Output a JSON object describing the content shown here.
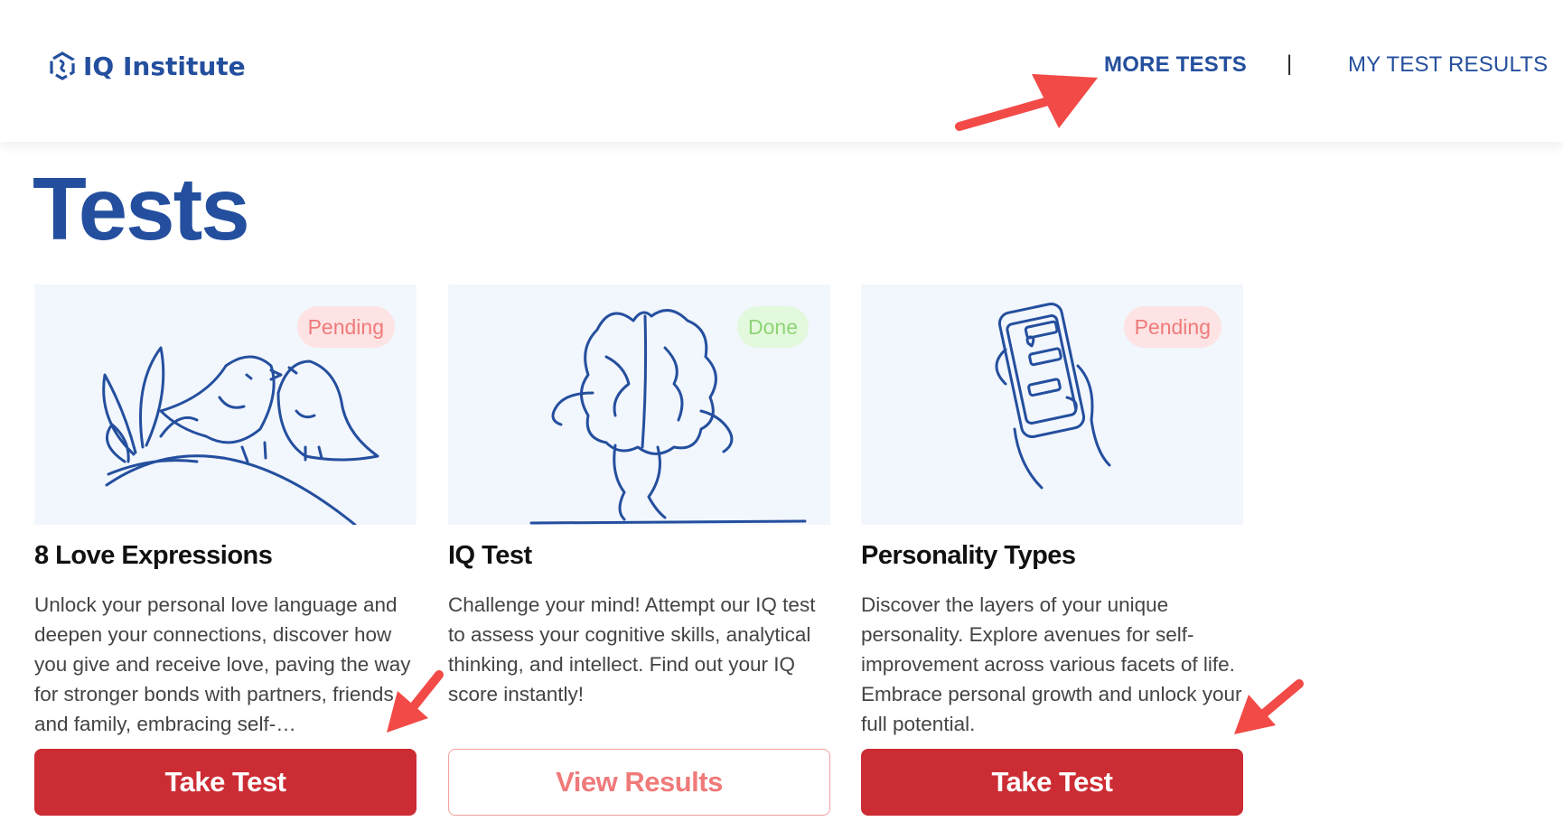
{
  "header": {
    "logo_text": "IQ Institute",
    "nav": {
      "more_tests": "MORE TESTS",
      "separator": "|",
      "my_results": "MY TEST RESULTS"
    }
  },
  "page": {
    "title": "Tests"
  },
  "cards": [
    {
      "title": "8 Love Expressions",
      "status": "Pending",
      "description": "Unlock your personal love language and deepen your connections, discover how you give and receive love, paving the way for stronger bonds with partners, friends, and family, embracing self-…",
      "button": "Take Test",
      "illustration": "birds-illustration"
    },
    {
      "title": "IQ Test",
      "status": "Done",
      "description": "Challenge your mind! Attempt our IQ test to assess your cognitive skills, analytical thinking, and intellect. Find out your IQ score instantly!",
      "button": "View Results",
      "illustration": "brain-illustration"
    },
    {
      "title": "Personality Types",
      "status": "Pending",
      "description": "Discover the layers of your unique personality. Explore avenues for self-improvement across various facets of life. Embrace personal growth and unlock your full potential.",
      "button": "Take Test",
      "illustration": "phone-illustration"
    }
  ],
  "colors": {
    "brand_blue": "#244f9e",
    "primary_red": "#cc2c33",
    "pending_text": "#f07a7a",
    "done_text": "#8fd477",
    "annotation_arrow": "#f24a46"
  }
}
